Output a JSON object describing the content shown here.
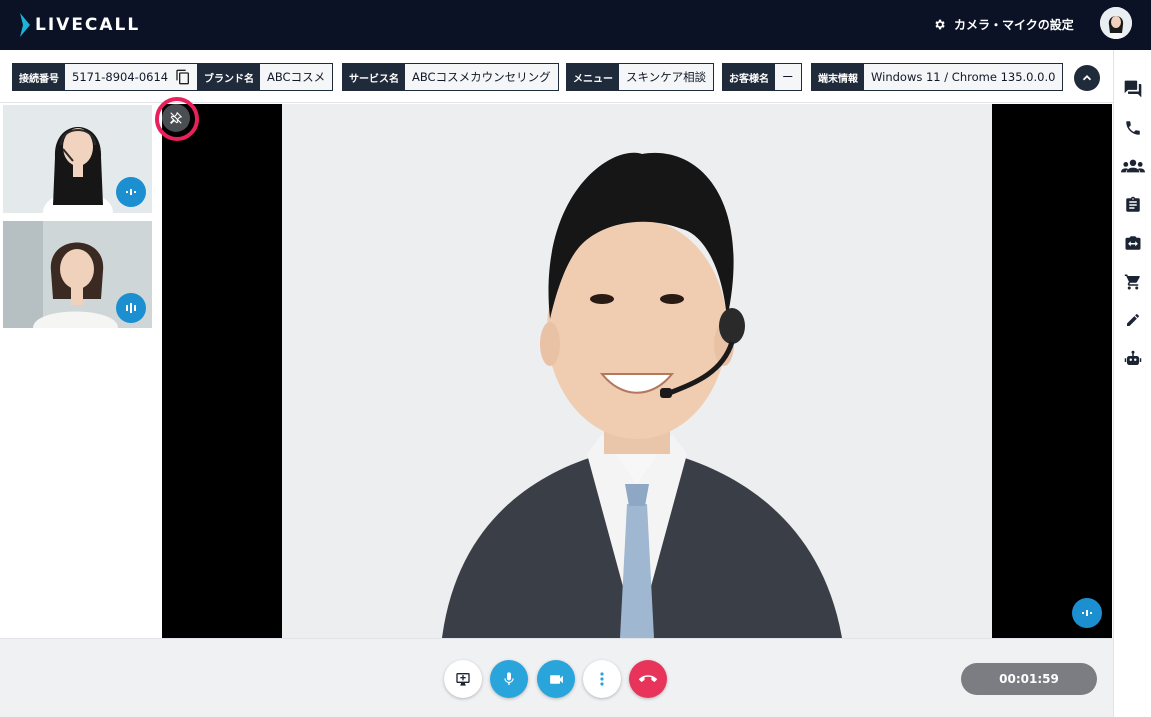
{
  "app": {
    "logo_text": "LIVECALL",
    "brand_color": "#1bb3d6"
  },
  "header": {
    "settings_label": "カメラ・マイクの設定",
    "settings_icon": "gear-icon",
    "avatar_icon": "user-avatar"
  },
  "info": {
    "connection": {
      "label": "接続番号",
      "value": "5171-8904-0614",
      "icon": "copy-icon"
    },
    "brand": {
      "label": "ブランド名",
      "value": "ABCコスメ"
    },
    "service": {
      "label": "サービス名",
      "value": "ABCコスメカウンセリング"
    },
    "menu": {
      "label": "メニュー",
      "value": "スキンケア相談"
    },
    "customer": {
      "label": "お客様名",
      "value": "ー"
    },
    "device": {
      "label": "端末情報",
      "value": "Windows 11 / Chrome 135.0.0.0"
    },
    "collapse_icon": "chevron-up-icon"
  },
  "rail": {
    "items": [
      {
        "icon": "chat-icon"
      },
      {
        "icon": "phone-icon"
      },
      {
        "icon": "group-icon"
      },
      {
        "icon": "clipboard-icon"
      },
      {
        "icon": "camera-switch-icon"
      },
      {
        "icon": "cart-icon"
      },
      {
        "icon": "pencil-icon"
      },
      {
        "icon": "robot-icon"
      }
    ]
  },
  "participants": [
    {
      "name": "operator-with-headset",
      "audio_icon": "audio-level-icon"
    },
    {
      "name": "customer",
      "audio_icon": "audio-level-icon"
    }
  ],
  "stage": {
    "pin_icon": "unpin-icon",
    "audio_icon": "audio-level-icon"
  },
  "controls": {
    "buttons": [
      {
        "icon": "screen-share-icon",
        "color": "#ffffff"
      },
      {
        "icon": "microphone-icon",
        "color": "#2aa5dc"
      },
      {
        "icon": "video-camera-icon",
        "color": "#2aa5dc"
      },
      {
        "icon": "more-vertical-icon",
        "color": "#ffffff"
      },
      {
        "icon": "hang-up-icon",
        "color": "#e8345a"
      }
    ],
    "timer": "00:01:59"
  }
}
